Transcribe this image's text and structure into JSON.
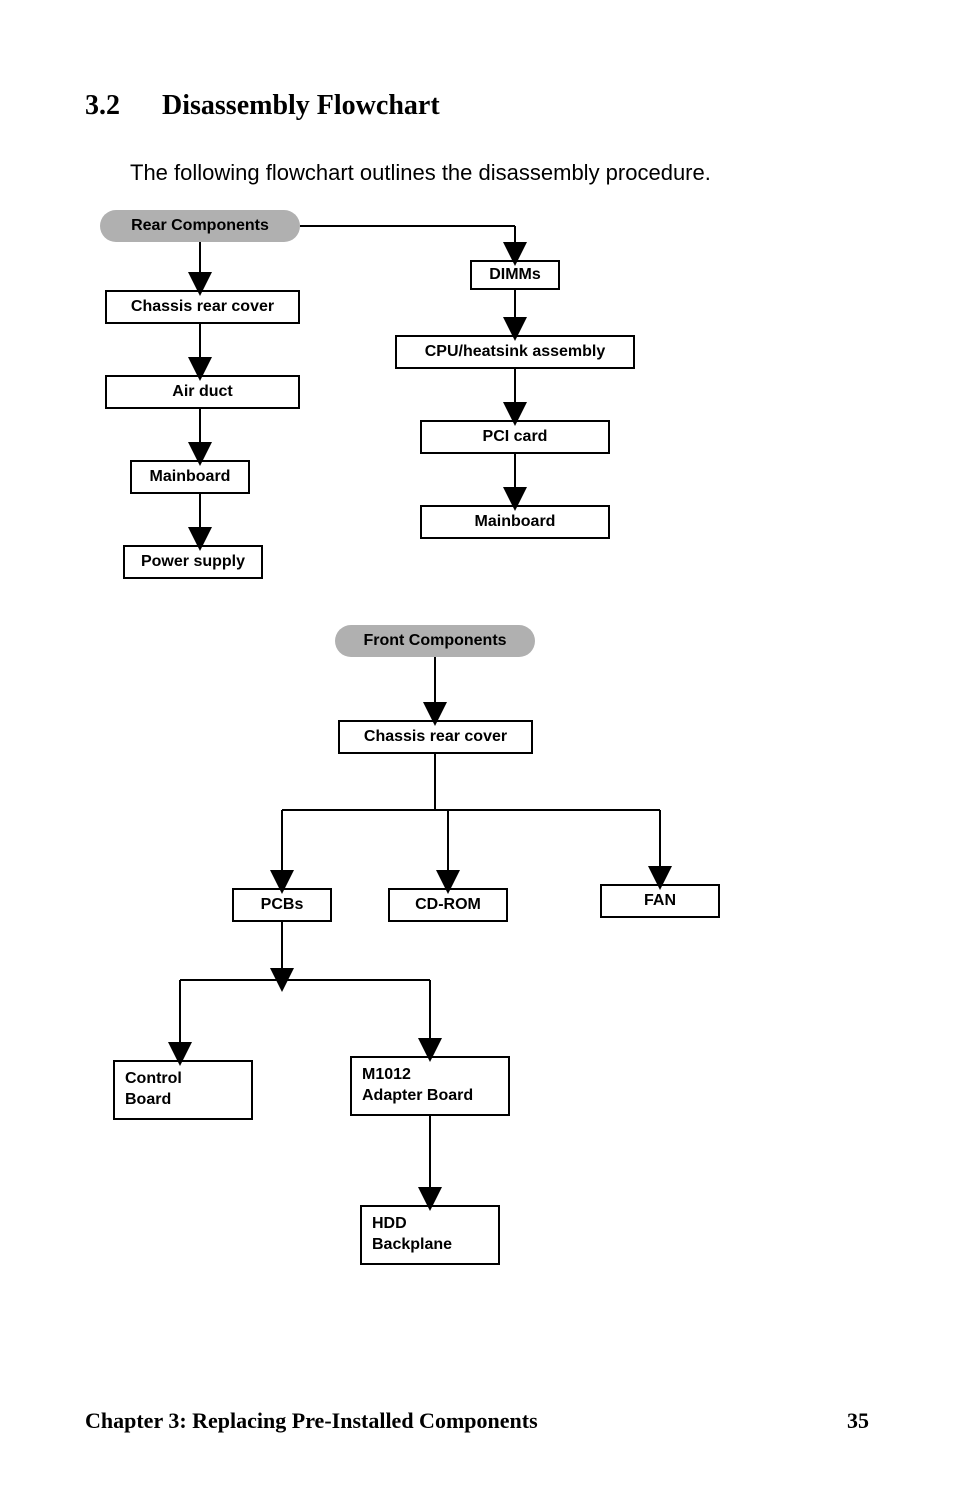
{
  "heading_num": "3.2",
  "heading_title": "Disassembly Flowchart",
  "intro": "The following flowchart outlines the disassembly procedure.",
  "rear": {
    "start": "Rear Components",
    "left": [
      "Chassis rear cover",
      "Air duct",
      "Mainboard",
      "Power supply"
    ],
    "right": [
      "DIMMs",
      "CPU/heatsink assembly",
      "PCI card",
      "Mainboard"
    ]
  },
  "front": {
    "start": "Front Components",
    "cover": "Chassis rear cover",
    "row": [
      "PCBs",
      "CD-ROM",
      "FAN"
    ],
    "control": "Control\nBoard",
    "adapter": "M1012\nAdapter Board",
    "backplane": "HDD\nBackplane"
  },
  "footer": {
    "chapter": "Chapter 3: Replacing Pre-Installed Components",
    "page": "35"
  },
  "chart_data": {
    "type": "flowchart",
    "title": "Disassembly Flowchart",
    "trees": [
      {
        "root": "Rear Components",
        "branches": [
          [
            "Chassis rear cover",
            "Air duct",
            "Mainboard",
            "Power supply"
          ],
          [
            "DIMMs",
            "CPU/heatsink assembly",
            "PCI card",
            "Mainboard"
          ]
        ]
      },
      {
        "root": "Front Components",
        "sequence": [
          "Chassis rear cover"
        ],
        "split_to": [
          "PCBs",
          "CD-ROM",
          "FAN"
        ],
        "then_from": "PCBs",
        "split_to_2": [
          "Control Board",
          "M1012 Adapter Board"
        ],
        "then_from_2": "M1012 Adapter Board",
        "final": "HDD Backplane"
      }
    ]
  }
}
